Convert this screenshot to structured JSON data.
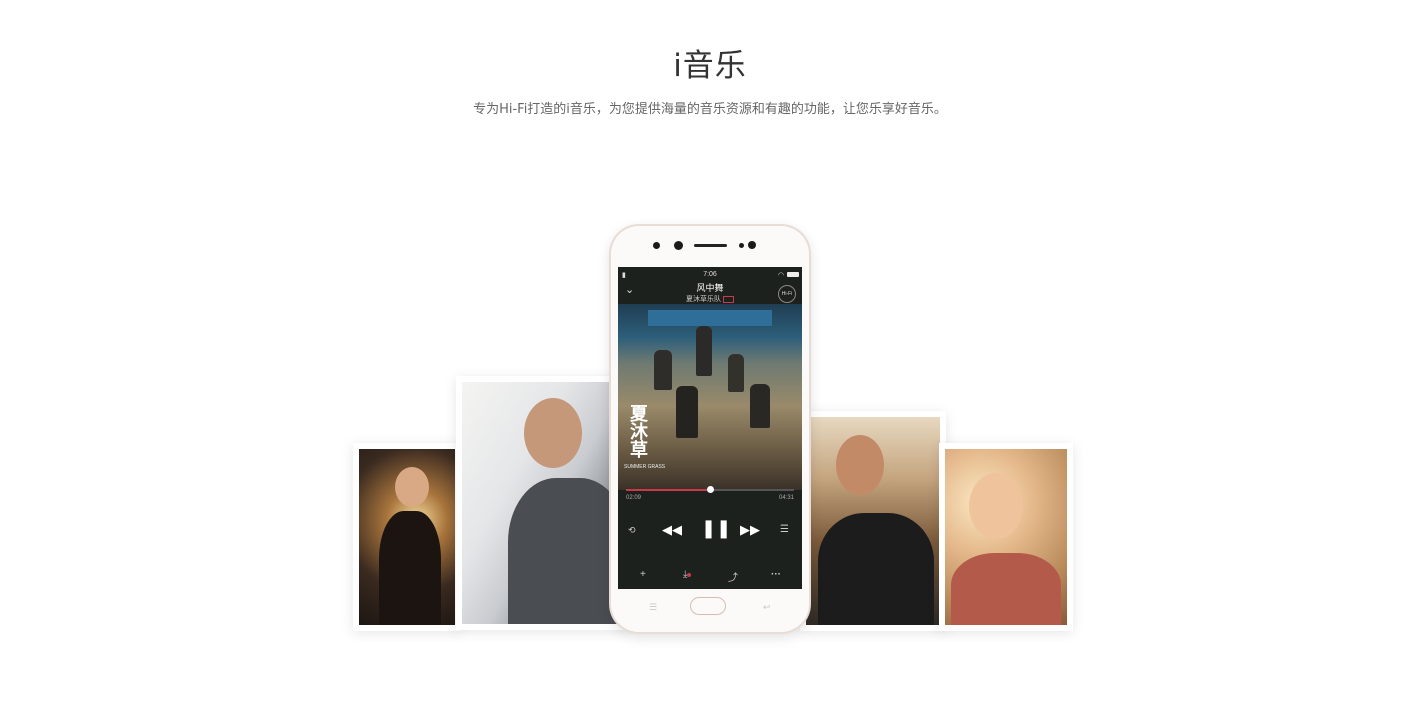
{
  "header": {
    "title": "i音乐",
    "subtitle": "专为Hi-Fi打造的i音乐，为您提供海量的音乐资源和有趣的功能，让您乐享好音乐。"
  },
  "phone_screen": {
    "status_time": "7:06",
    "song_title": "风中舞",
    "artist": "夏沐草乐队",
    "hifi_badge": "Hi-Fi",
    "cover_text": "夏沐草",
    "cover_subtext": "SUMMER GRASS",
    "time_elapsed": "02:09",
    "time_total": "04:31",
    "progress_fraction": 0.5
  },
  "icons": {
    "back": "chevron-down-icon",
    "repeat": "repeat-icon",
    "prev": "previous-icon",
    "play_pause": "pause-icon",
    "next": "next-icon",
    "playlist": "playlist-icon",
    "add": "add-icon",
    "download": "download-icon",
    "share": "share-icon",
    "more": "more-icon"
  },
  "colors": {
    "accent": "#c83a4a",
    "phone_body": "#fbfaf9",
    "screen_bg": "#1d211e"
  }
}
